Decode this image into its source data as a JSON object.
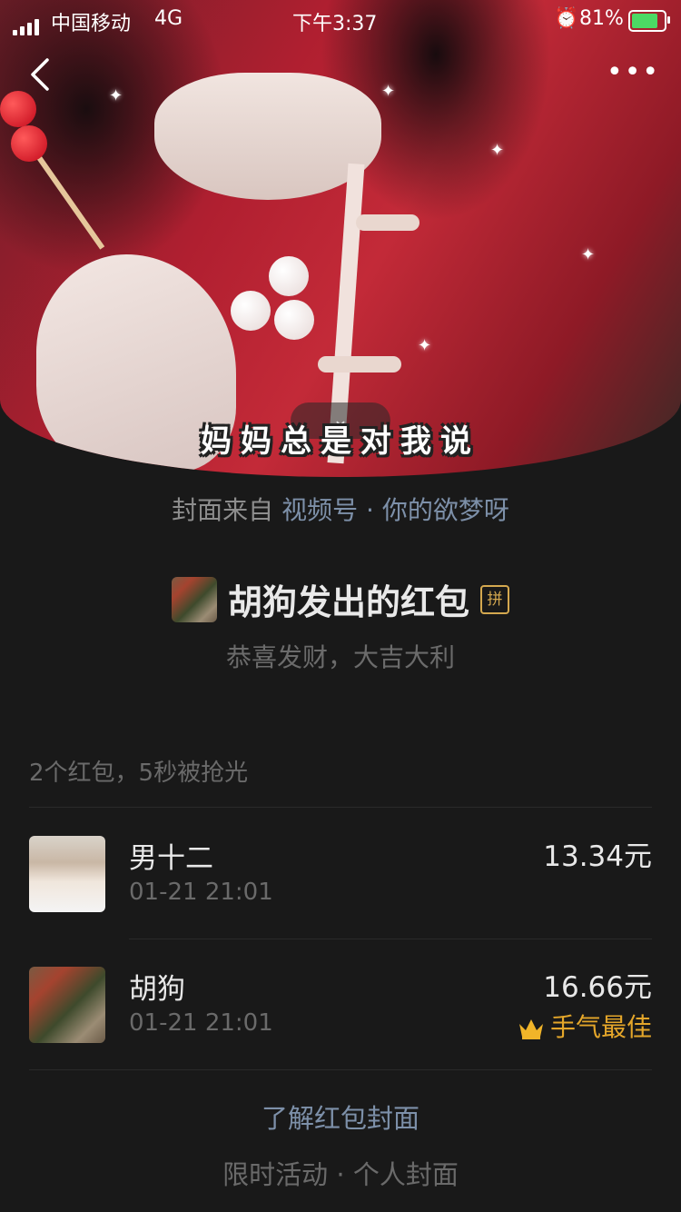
{
  "status_bar": {
    "carrier": "中国移动",
    "network": "4G",
    "time": "下午3:37",
    "battery_percent": "81%",
    "battery_level": 0.81
  },
  "cover": {
    "subtitle": "妈妈总是对我说",
    "collapse_icon": "chevron-down-icon"
  },
  "cover_source": {
    "prefix": "封面来自",
    "channel": "视频号",
    "separator": "·",
    "author": "你的欲梦呀"
  },
  "packet": {
    "title": "胡狗发出的红包",
    "badge": "拼",
    "blessing": "恭喜发财，大吉大利",
    "summary": "2个红包，5秒被抢光"
  },
  "records": [
    {
      "name": "男十二",
      "time": "01-21 21:01",
      "amount": "13.34元",
      "luck": ""
    },
    {
      "name": "胡狗",
      "time": "01-21 21:01",
      "amount": "16.66元",
      "luck": "手气最佳"
    }
  ],
  "footer": {
    "learn_link": "了解红包封面",
    "links": "限时活动 · 个人封面"
  },
  "colors": {
    "background": "#191919",
    "link": "#7d90a9",
    "best_luck": "#e4a62a",
    "badge": "#d4a84f"
  }
}
